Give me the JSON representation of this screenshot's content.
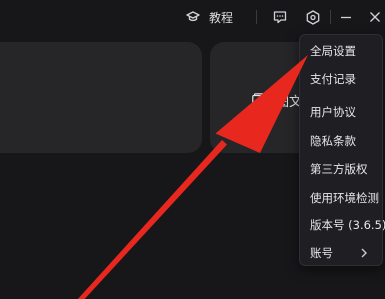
{
  "titlebar": {
    "tutorial_label": "教程"
  },
  "cards": {
    "right_text": "图文"
  },
  "menu": {
    "items": [
      {
        "label": "全局设置"
      },
      {
        "label": "支付记录"
      },
      {
        "label": "用户协议"
      },
      {
        "label": "隐私条款"
      },
      {
        "label": "第三方版权"
      },
      {
        "label": "使用环境检测"
      },
      {
        "label": "版本号 (3.6.5)"
      },
      {
        "label": "账号"
      }
    ]
  },
  "icons": {
    "tutorial": "graduation-cap-icon",
    "feedback": "chat-feedback-icon",
    "settings": "hexagon-gear-icon",
    "minimize": "minimize-icon",
    "close": "close-icon",
    "card": "image-text-icon",
    "submenu": "chevron-right-icon"
  },
  "colors": {
    "background": "#17171a",
    "card": "#262629",
    "menu": "#1f1f23",
    "annotation_arrow": "#e8281f"
  }
}
